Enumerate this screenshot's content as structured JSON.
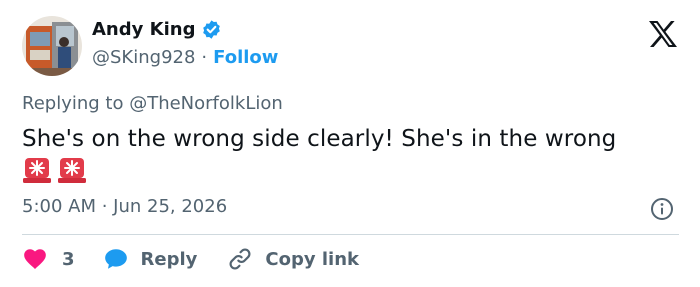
{
  "author": {
    "name": "Andy King",
    "handle": "@SKing928",
    "separator": "·",
    "follow_label": "Follow"
  },
  "reply_context": {
    "prefix": "Replying to ",
    "mention": "@TheNorfolkLion"
  },
  "tweet": {
    "text": "She's on the wrong side clearly! She's in the wrong",
    "emojis": [
      "police-light-emoji",
      "police-light-emoji"
    ]
  },
  "meta": {
    "timestamp": "5:00 AM · Jun 25, 2026"
  },
  "actions": {
    "like_count": "3",
    "reply_label": "Reply",
    "copy_label": "Copy link"
  },
  "colors": {
    "accent": "#1d9bf0",
    "secondary_text": "#536471",
    "like": "#f91880",
    "reply_bubble": "#1d9bf0",
    "divider": "#cfd9de"
  }
}
